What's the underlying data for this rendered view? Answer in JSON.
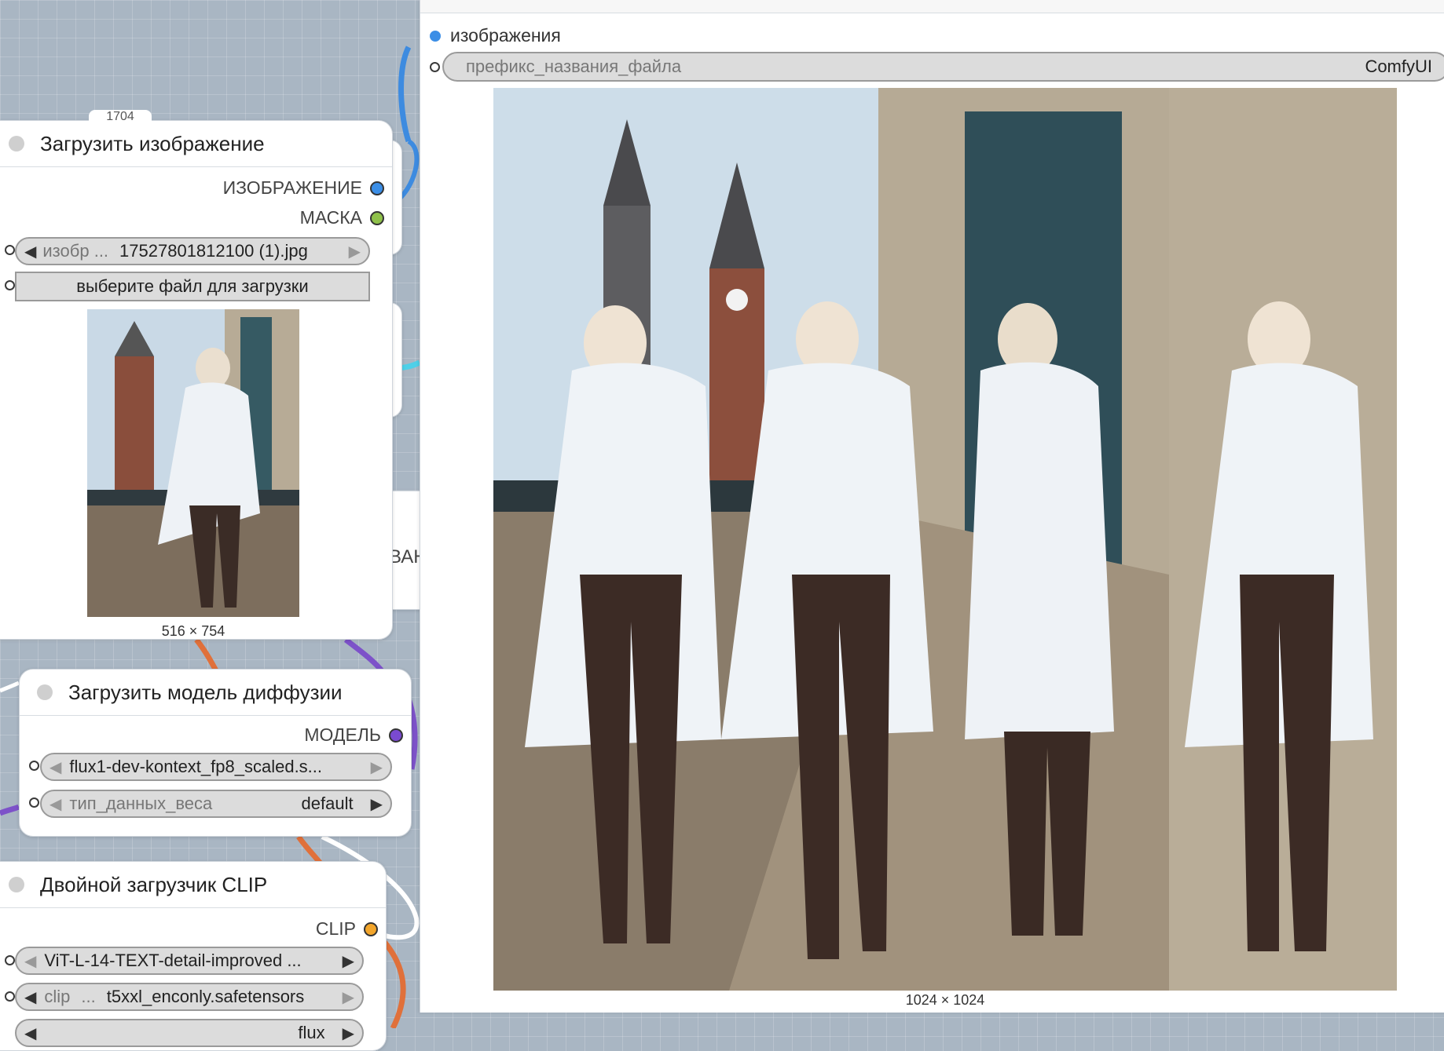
{
  "load_image_node": {
    "title": "Загрузить изображение",
    "outputs": [
      "ИЗОБРАЖЕНИЕ",
      "МАСКА"
    ],
    "image_widget_label": "изобр ...",
    "image_widget_value": "17527801812100 (1).jpg",
    "upload_button": "выберите файл для загрузки",
    "preview_size": "516 × 754",
    "peek_badge": "1704"
  },
  "diffusion_node": {
    "title": "Загрузить модель диффузии",
    "output": "МОДЕЛЬ",
    "model_value": "flux1-dev-kontext_fp8_scaled.s...",
    "dtype_label": "тип_данных_веса",
    "dtype_value": "default"
  },
  "clip_node": {
    "title": "Двойной загрузчик CLIP",
    "output": "CLIP",
    "clip1_value": "ViT-L-14-TEXT-detail-improved ...",
    "clip2_label": "clip",
    "clip2_value": "t5xxl_enconly.safetensors",
    "clip3_value": "flux"
  },
  "hidden_node_fragment": "ВАН",
  "save_panel": {
    "input_label": "изображения",
    "prefix_label": "префикс_названия_файла",
    "prefix_value": "ComfyUI",
    "output_size": "1024 × 1024"
  },
  "colors": {
    "image_port": "#3b8ee6",
    "mask_port": "#8fc14a",
    "model_port": "#7a4ad0",
    "clip_port": "#f2a52b",
    "wire_blue": "#3d8be0",
    "wire_orange": "#e0703a",
    "wire_purple": "#7d52c9",
    "wire_cyan": "#4fd0e8"
  }
}
